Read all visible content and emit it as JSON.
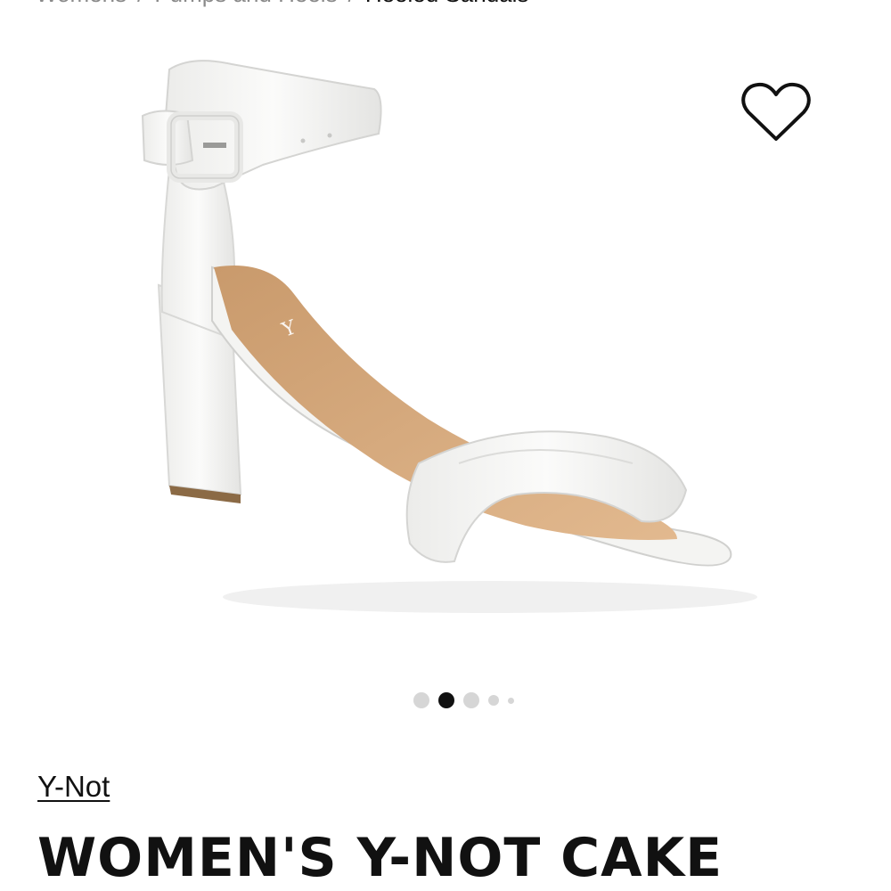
{
  "breadcrumb": {
    "items": [
      "Womens",
      "Pumps and Heels",
      "Heeled Sandals"
    ],
    "separator": "/"
  },
  "product": {
    "brand": "Y-Not",
    "title": "WOMEN'S Y-NOT CAKE",
    "image_description_icon": "white-block-heel-sandal-image"
  },
  "gallery": {
    "total_images": 5,
    "active_index": 2
  },
  "icons": {
    "wishlist": "heart-outline-icon"
  },
  "colors": {
    "text": "#111111",
    "muted": "#8a8a8a",
    "dot_inactive": "#d6d6d6",
    "dot_active": "#111111"
  }
}
